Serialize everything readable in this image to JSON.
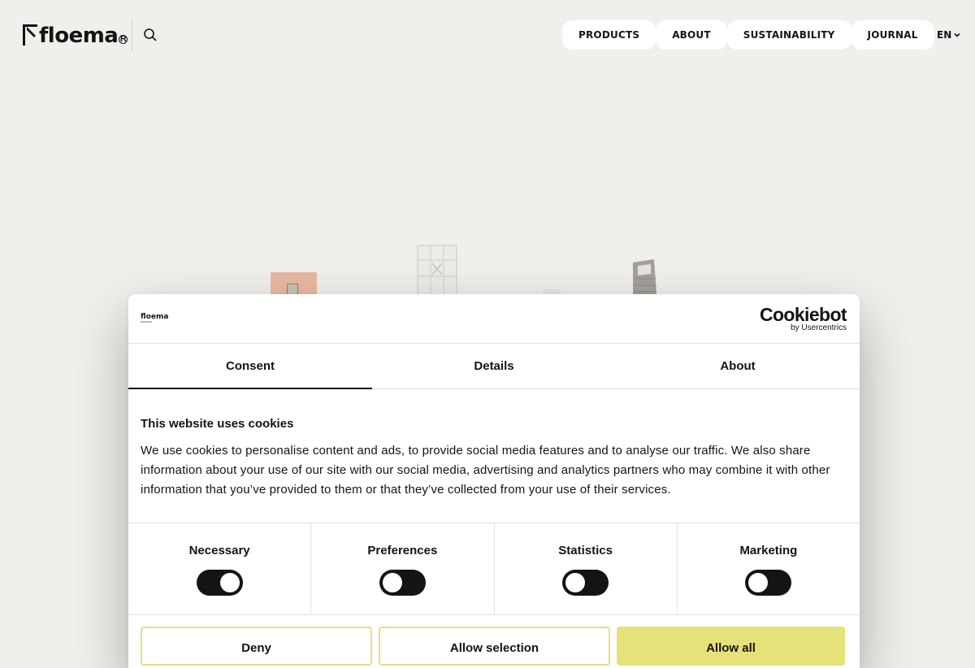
{
  "header": {
    "logo_text": "floema",
    "logo_reg": "R",
    "nav": [
      "PRODUCTS",
      "ABOUT",
      "SUSTAINABILITY",
      "JOURNAL"
    ],
    "language": "EN"
  },
  "icons": {
    "search": "search-icon",
    "lang_chevron": "chevron-down-icon"
  },
  "cookie_dialog": {
    "brand_logo": "floema",
    "provider_name": "Cookiebot",
    "provider_sub": "by Usercentrics",
    "tabs": [
      "Consent",
      "Details",
      "About"
    ],
    "active_tab": "Consent",
    "heading": "This website uses cookies",
    "body": "We use cookies to personalise content and ads, to provide social media features and to analyse our traffic. We also share information about your use of our site with our social media, advertising and analytics partners who may combine it with other information that you’ve provided to them or that they’ve collected from your use of their services.",
    "categories": [
      {
        "label": "Necessary",
        "enabled": true
      },
      {
        "label": "Preferences",
        "enabled": false
      },
      {
        "label": "Statistics",
        "enabled": false
      },
      {
        "label": "Marketing",
        "enabled": false
      }
    ],
    "buttons": {
      "deny": "Deny",
      "allow_selection": "Allow selection",
      "allow_all": "Allow all"
    }
  },
  "colors": {
    "background": "#f1efeb",
    "accent": "#e6e27a",
    "text": "#141414"
  }
}
